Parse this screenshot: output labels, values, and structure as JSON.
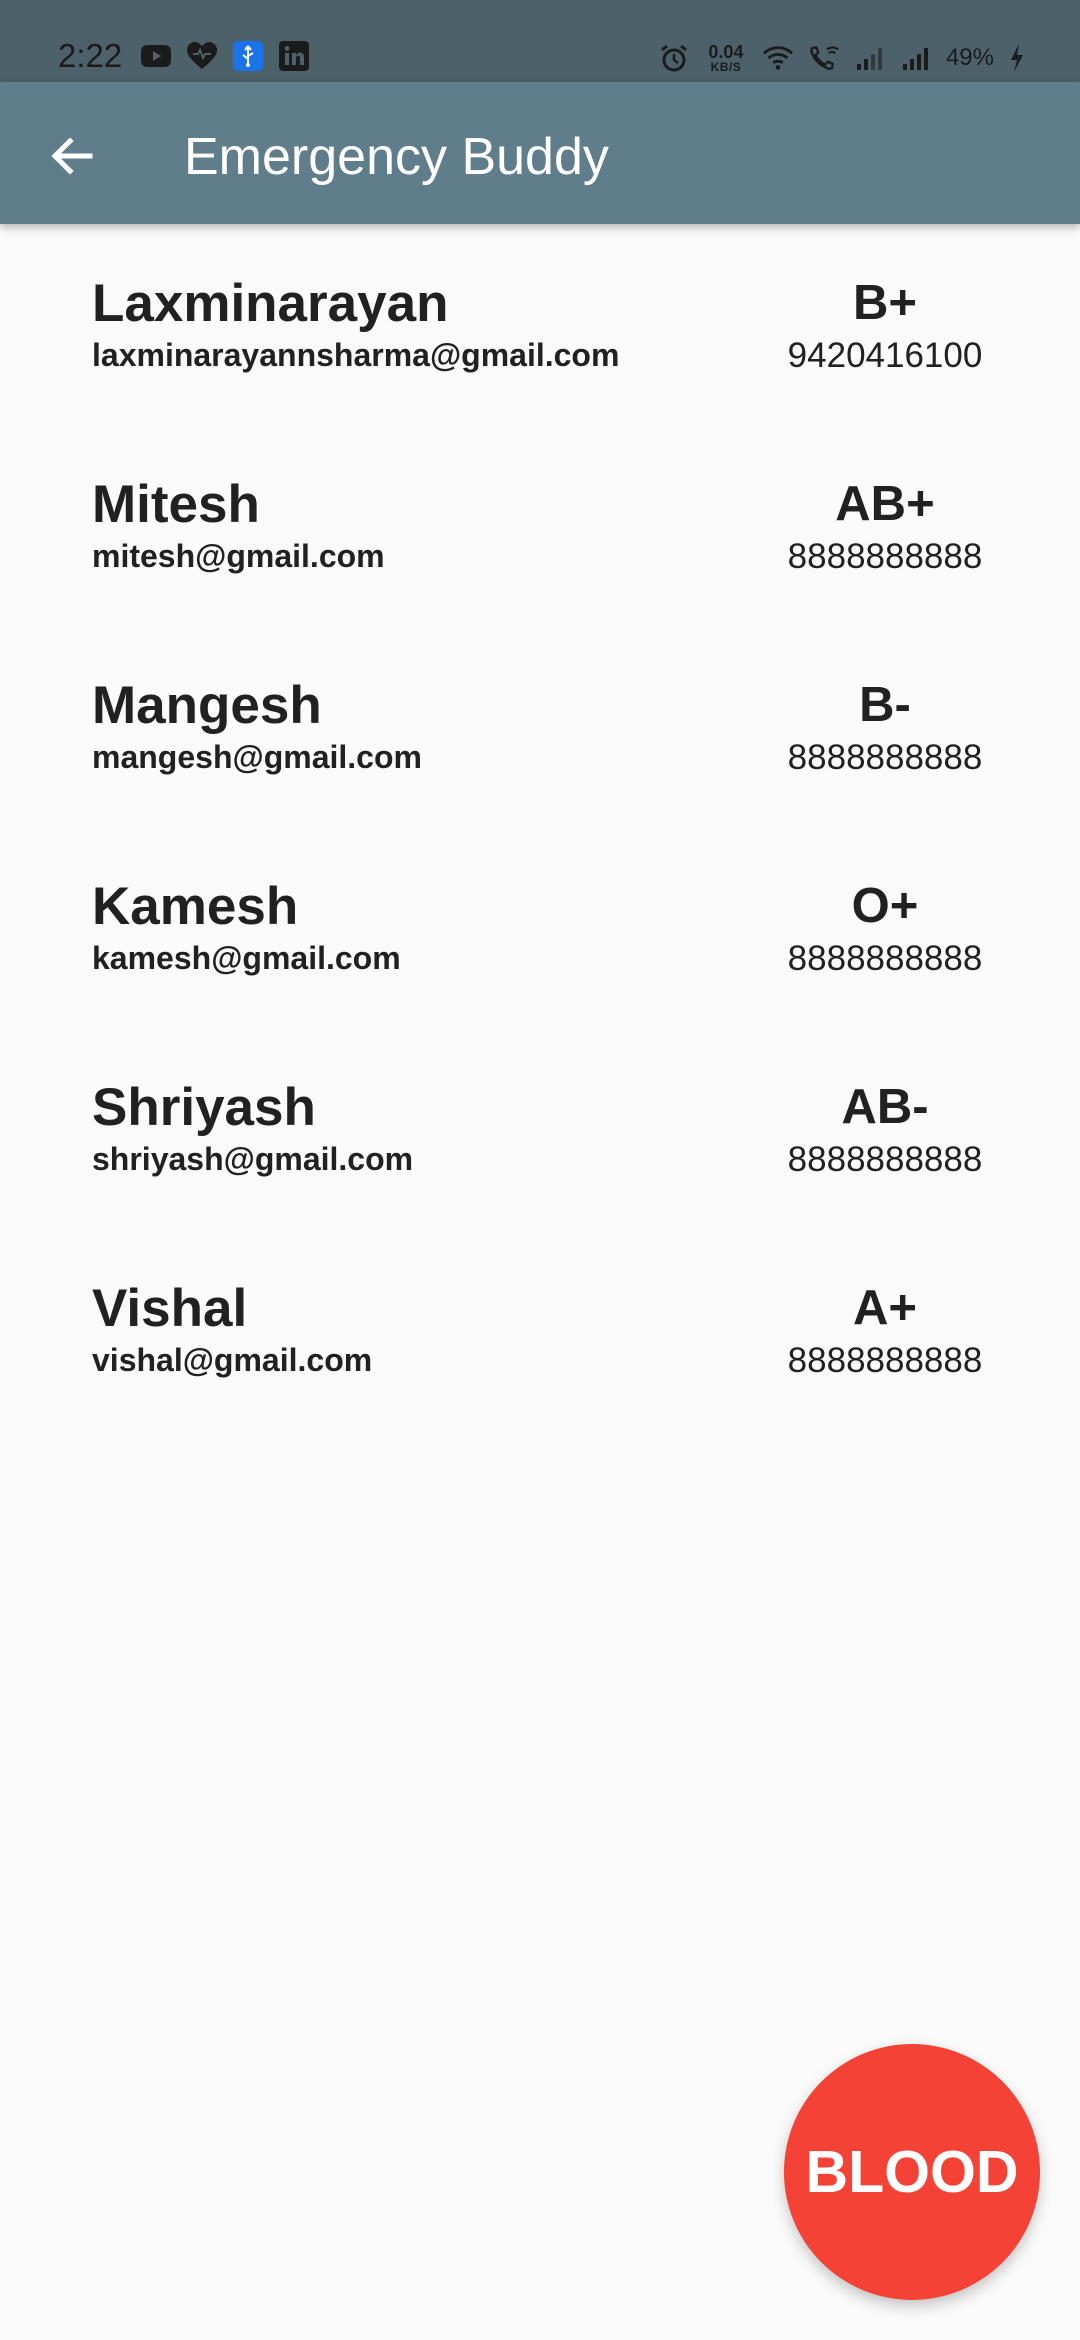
{
  "status_bar": {
    "time": "2:22",
    "left_icons": [
      "youtube-icon",
      "heart-icon",
      "usb-icon",
      "linkedin-icon"
    ],
    "net_speed_value": "0.04",
    "net_speed_unit": "KB/S",
    "battery_percent": "49%"
  },
  "app_bar": {
    "title": "Emergency Buddy",
    "back_icon": "arrow-back-icon",
    "background_color": "#607d8b"
  },
  "contacts": [
    {
      "name": "Laxminarayan",
      "email": "laxminarayannsharma@gmail.com",
      "blood_group": "B+",
      "phone": "9420416100"
    },
    {
      "name": "Mitesh",
      "email": "mitesh@gmail.com",
      "blood_group": "AB+",
      "phone": "8888888888"
    },
    {
      "name": "Mangesh",
      "email": "mangesh@gmail.com",
      "blood_group": "B-",
      "phone": "8888888888"
    },
    {
      "name": "Kamesh",
      "email": "kamesh@gmail.com",
      "blood_group": "O+",
      "phone": "8888888888"
    },
    {
      "name": "Shriyash",
      "email": "shriyash@gmail.com",
      "blood_group": "AB-",
      "phone": "8888888888"
    },
    {
      "name": "Vishal",
      "email": "vishal@gmail.com",
      "blood_group": "A+",
      "phone": "8888888888"
    }
  ],
  "fab": {
    "label": "BLOOD",
    "color": "#f44336"
  }
}
